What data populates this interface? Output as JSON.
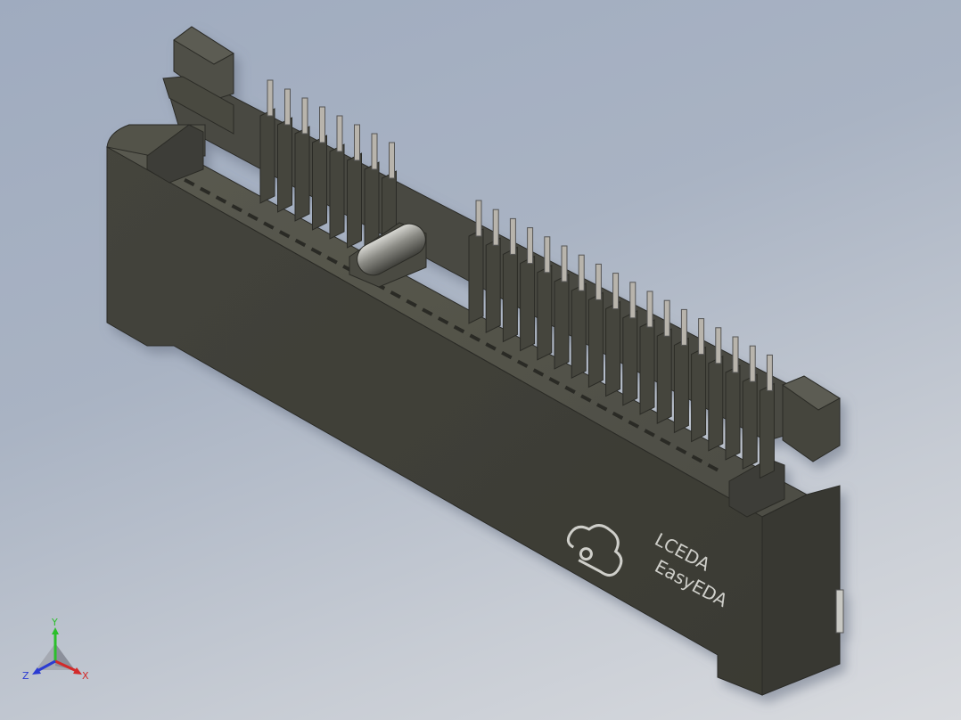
{
  "model": {
    "logo_line1": "LCEDA",
    "logo_line2": "EasyEDA",
    "logo_icon": "cloud-logo-icon",
    "body_color": "#3d3d35",
    "pin_color": "#b8b4ac",
    "peg_color": "#8a8a84"
  },
  "triad": {
    "x_label": "X",
    "y_label": "Y",
    "z_label": "Z",
    "x_color": "#d22a2a",
    "y_color": "#2bbf2b",
    "z_color": "#2b3bd2"
  }
}
